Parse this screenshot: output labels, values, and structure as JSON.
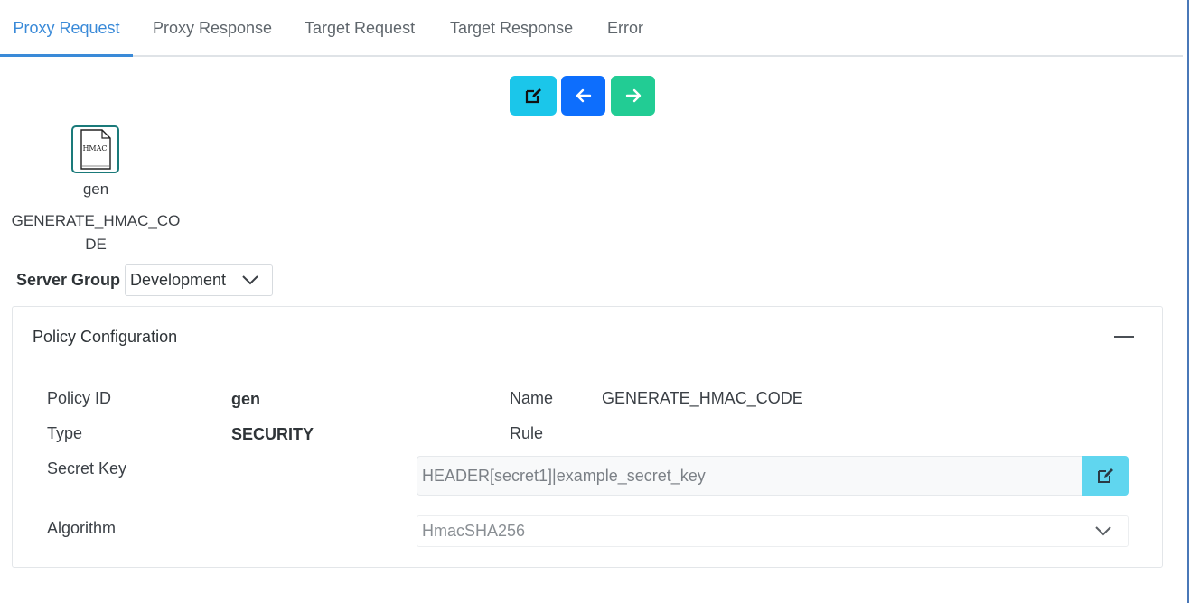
{
  "tabs": [
    {
      "label": "Proxy Request",
      "active": true
    },
    {
      "label": "Proxy Response"
    },
    {
      "label": "Target Request"
    },
    {
      "label": "Target Response"
    },
    {
      "label": "Error"
    }
  ],
  "toolbar": {
    "edit_icon": "edit-icon",
    "back_icon": "arrow-left-icon",
    "forward_icon": "arrow-right-icon",
    "colors": {
      "edit": "#1bc6ea",
      "back": "#0d6efd",
      "forward": "#22cc94"
    }
  },
  "policy_node": {
    "icon_label": "HMAC",
    "name": "gen",
    "type": "GENERATE_HMAC_CODE"
  },
  "server_group": {
    "label": "Server Group",
    "value": "Development"
  },
  "policy_config": {
    "title": "Policy Configuration",
    "policy_id_label": "Policy ID",
    "policy_id": "gen",
    "name_label": "Name",
    "name": "GENERATE_HMAC_CODE",
    "type_label": "Type",
    "type": "SECURITY",
    "rule_label": "Rule",
    "secret_key_label": "Secret Key",
    "secret_key": "HEADER[secret1]|example_secret_key",
    "algorithm_label": "Algorithm",
    "algorithm": "HmacSHA256"
  }
}
